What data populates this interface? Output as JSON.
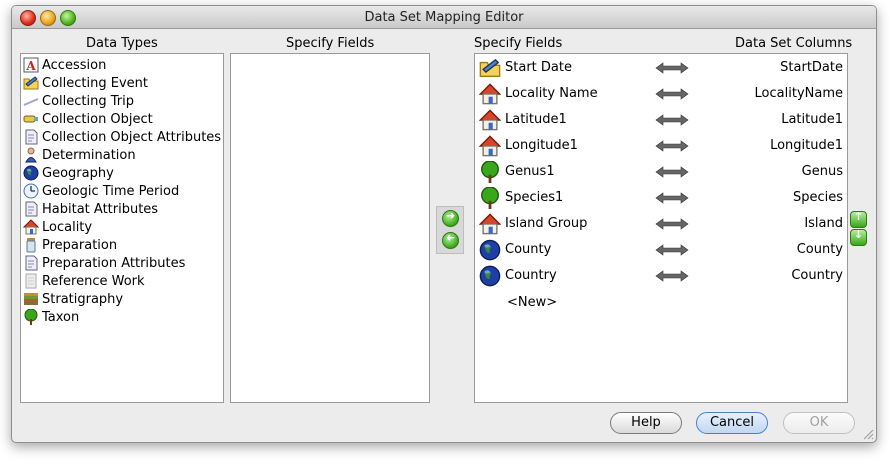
{
  "window": {
    "title": "Data Set Mapping Editor"
  },
  "headers": {
    "data_types": "Data Types",
    "specify_fields_left": "Specify Fields",
    "specify_fields_right": "Specify Fields",
    "data_set_columns": "Data Set Columns"
  },
  "data_types": [
    {
      "label": "Accession",
      "icon": "accession-icon"
    },
    {
      "label": "Collecting Event",
      "icon": "folder-icon"
    },
    {
      "label": "Collecting Trip",
      "icon": "trip-icon"
    },
    {
      "label": "Collection Object",
      "icon": "collection-object-icon"
    },
    {
      "label": "Collection Object Attributes",
      "icon": "attributes-icon"
    },
    {
      "label": "Determination",
      "icon": "person-icon"
    },
    {
      "label": "Geography",
      "icon": "globe-icon"
    },
    {
      "label": "Geologic Time Period",
      "icon": "clock-icon"
    },
    {
      "label": "Habitat Attributes",
      "icon": "attributes-icon"
    },
    {
      "label": "Locality",
      "icon": "house-icon"
    },
    {
      "label": "Preparation",
      "icon": "jar-icon"
    },
    {
      "label": "Preparation Attributes",
      "icon": "attributes-icon"
    },
    {
      "label": "Reference Work",
      "icon": "reference-icon"
    },
    {
      "label": "Stratigraphy",
      "icon": "strata-icon"
    },
    {
      "label": "Taxon",
      "icon": "tree-icon"
    }
  ],
  "mappings": [
    {
      "field": "Start Date",
      "icon": "folder-icon",
      "column": "StartDate"
    },
    {
      "field": "Locality Name",
      "icon": "house-icon",
      "column": "LocalityName"
    },
    {
      "field": "Latitude1",
      "icon": "house-icon",
      "column": "Latitude1"
    },
    {
      "field": "Longitude1",
      "icon": "house-icon",
      "column": "Longitude1"
    },
    {
      "field": "Genus1",
      "icon": "tree-icon",
      "column": "Genus"
    },
    {
      "field": "Species1",
      "icon": "tree-icon",
      "column": "Species"
    },
    {
      "field": "Island Group",
      "icon": "house-icon",
      "column": "Island"
    },
    {
      "field": "County",
      "icon": "globe-icon",
      "column": "County"
    },
    {
      "field": "Country",
      "icon": "globe-icon",
      "column": "Country"
    }
  ],
  "new_row_label": "<New>",
  "buttons": {
    "help": "Help",
    "cancel": "Cancel",
    "ok": "OK"
  },
  "colors": {
    "accent_green": "#3aa61c",
    "default_button_blue": "#4a7fc9"
  }
}
